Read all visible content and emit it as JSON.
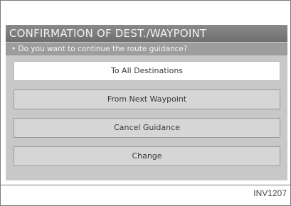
{
  "dialog": {
    "title": "CONFIRMATION OF DEST./WAYPOINT",
    "question": "• Do you want to continue the route guidance?",
    "options": [
      {
        "label": "To All Destinations",
        "selected": true
      },
      {
        "label": "From Next Waypoint",
        "selected": false
      },
      {
        "label": "Cancel Guidance",
        "selected": false
      },
      {
        "label": "Change",
        "selected": false
      }
    ]
  },
  "figure_ref": "INV1207"
}
